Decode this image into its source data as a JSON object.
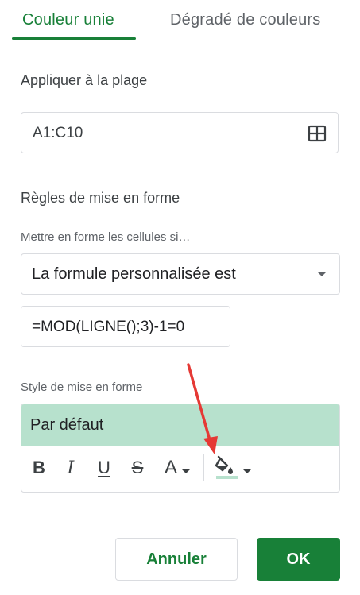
{
  "tabs": [
    {
      "label": "Couleur unie",
      "active": true
    },
    {
      "label": "Dégradé de couleurs",
      "active": false
    }
  ],
  "range": {
    "title": "Appliquer à la plage",
    "value": "A1:C10",
    "icon": "grid-select-icon"
  },
  "rules": {
    "title": "Règles de mise en forme",
    "condition_label": "Mettre en forme les cellules si…",
    "condition_value": "La formule personnalisée est",
    "formula_value": "=MOD(LIGNE();3)-1=0"
  },
  "format_style": {
    "label": "Style de mise en forme",
    "preview_text": "Par défaut",
    "preview_color": "#b7e1cd",
    "toolbar": {
      "bold": "B",
      "italic": "I",
      "underline": "U",
      "strikethrough": "S",
      "text_color": "A",
      "fill_color_icon": "fill-color-icon"
    }
  },
  "annotation": {
    "color": "#e53935",
    "icon": "red-arrow-pointer"
  },
  "actions": {
    "cancel_label": "Annuler",
    "ok_label": "OK"
  },
  "colors": {
    "accent": "#188038",
    "border": "#dadce0"
  }
}
